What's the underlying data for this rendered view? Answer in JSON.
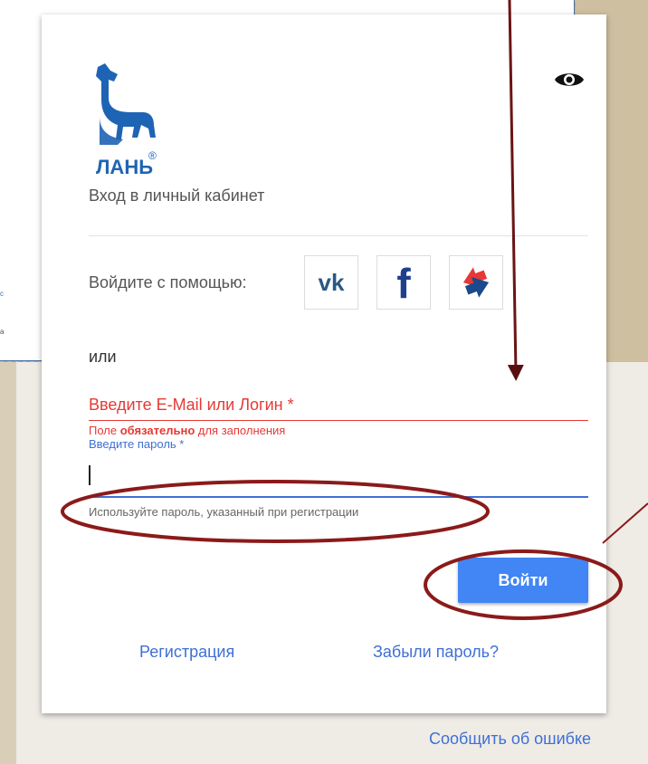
{
  "logo": {
    "brand_text": "ЛАНЬ",
    "registered_mark": "®"
  },
  "auth": {
    "title": "Вход в личный кабинет",
    "social_label": "Войдите с помощью:",
    "social_buttons": [
      {
        "network": "vk",
        "icon": "vk-icon"
      },
      {
        "network": "facebook",
        "icon": "facebook-icon"
      },
      {
        "network": "ok",
        "icon": "arrows-swap-icon"
      }
    ],
    "or_label": "или",
    "login": {
      "placeholder": "Введите E-Mail или Логин *",
      "value": "",
      "error_prefix": "Поле ",
      "error_bold": "обязательно",
      "error_suffix": " для заполнения"
    },
    "password": {
      "label": "Введите пароль *",
      "value": "",
      "hint": "Используйте пароль, указанный при регистрации"
    },
    "submit_label": "Войти",
    "register_link": "Регистрация",
    "forgot_link": "Забыли пароль?"
  },
  "report_link": "Сообщить об ошибке",
  "colors": {
    "accent": "#4285f4",
    "link": "#3f6fd6",
    "error": "#e53935",
    "annotation": "#8b1a1a"
  }
}
